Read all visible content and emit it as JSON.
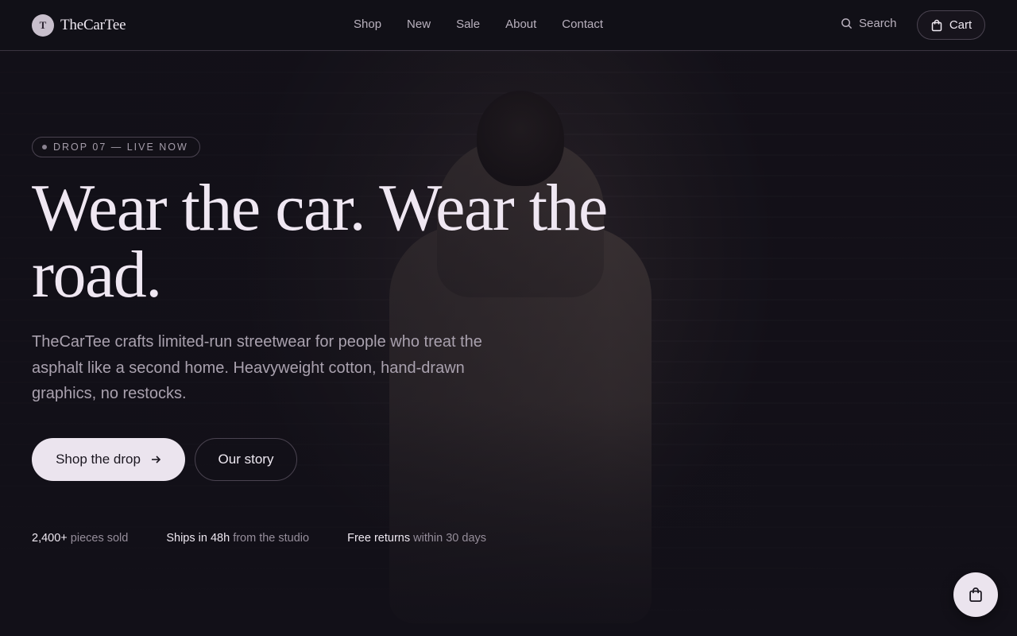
{
  "brand": {
    "mark": "T",
    "name": "TheCarTee"
  },
  "nav": {
    "items": [
      "Shop",
      "New",
      "Sale",
      "About",
      "Contact"
    ]
  },
  "header": {
    "search_label": "Search",
    "cart_label": "Cart"
  },
  "hero": {
    "badge": "DROP 07 — LIVE NOW",
    "headline_line1": "Wear the car. Wear the",
    "headline_line2": "road.",
    "lede": "TheCarTee crafts limited-run streetwear for people who treat the asphalt like a second home. Heavyweight cotton, hand-drawn graphics, no restocks.",
    "primary_cta": "Shop the drop",
    "secondary_cta": "Our story"
  },
  "stats": [
    {
      "strong": "2,400+",
      "muted": "pieces sold"
    },
    {
      "strong": "Ships in 48h",
      "muted": "from the studio"
    },
    {
      "strong": "Free returns",
      "muted": "within 30 days"
    }
  ],
  "colors": {
    "background": "#121018",
    "accent": "#ebe4ee",
    "text": "#efe9f2"
  }
}
